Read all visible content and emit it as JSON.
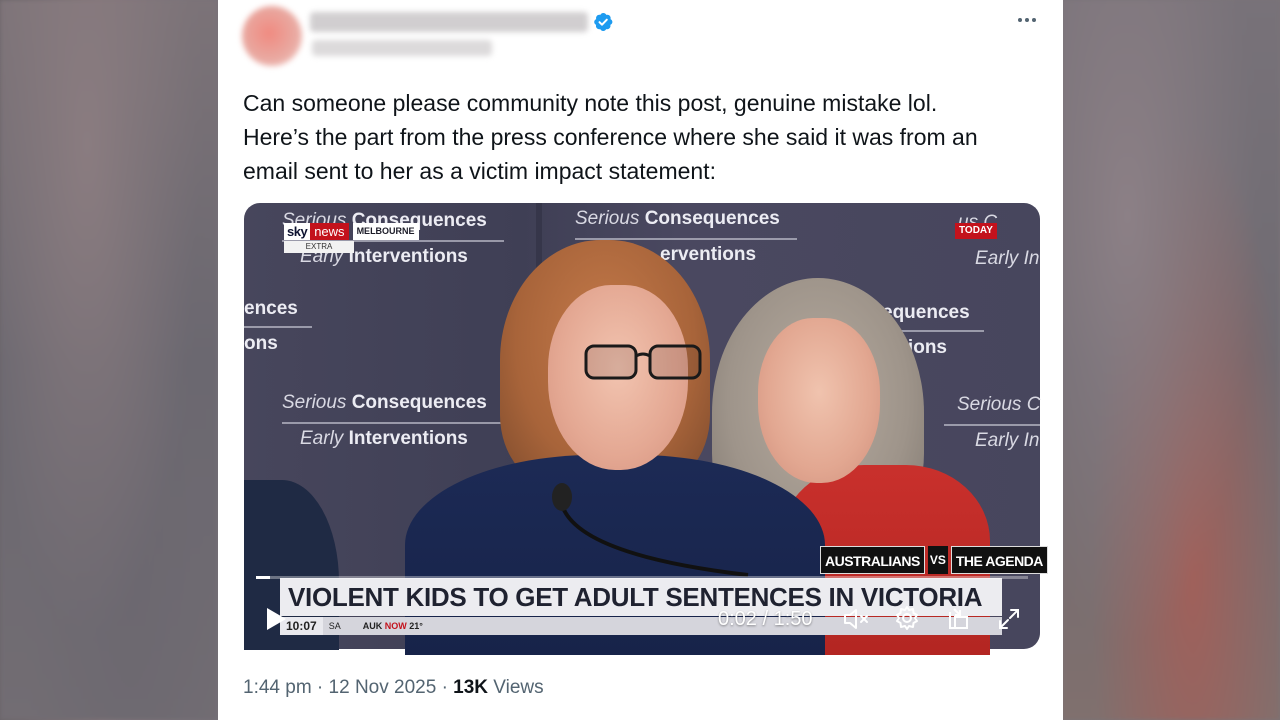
{
  "post": {
    "text_lines": [
      "Can someone please community note this post, genuine mistake lol.",
      "Here’s the part from the press conference where she said it was from an",
      "email sent to her as a victim impact statement:"
    ],
    "timestamp": "1:44 pm · 12 Nov 2025 · ",
    "views_count": "13K",
    "views_label": " Views"
  },
  "video": {
    "backdrop_serious": "Serious",
    "backdrop_consequences": "Consequences",
    "backdrop_early": "Early",
    "backdrop_interventions": "Interventions",
    "backdrop_frag_ences": "ences",
    "backdrop_frag_ons": "ons",
    "backdrop_frag_sequences": "equences",
    "backdrop_frag_ntions": "ntions",
    "backdrop_frag_terventions": "erventions",
    "backdrop_frag_serious_c": "Serious C",
    "backdrop_frag_early_in": "Early In",
    "backdrop_frag_us_c": "us C",
    "backdrop_frag_ces": "ces",
    "channel_sky": "sky",
    "channel_news": "news",
    "channel_city": "MELBOURNE",
    "channel_extra": "EXTRA",
    "today_badge": "TODAY",
    "program_left": "AUSTRALIANS",
    "program_vs": "VS",
    "program_right": "THE AGENDA",
    "headline": "VIOLENT KIDS TO GET ADULT SENTENCES IN VICTORIA",
    "ticker_time": "10:07",
    "ticker_zone": "SA",
    "ticker_auk": "AUK",
    "ticker_now": "NOW",
    "ticker_temp": "21°",
    "time_display": "0:02 / 1:50",
    "progress_fraction": 0.0178
  },
  "colors": {
    "verified": "#1d9bf0",
    "sky_red": "#c3121c",
    "text_secondary": "#536471",
    "text_primary": "#0f1419"
  },
  "icons": {
    "verified": "verified-badge-icon",
    "more": "more-options-icon",
    "play": "play-icon",
    "mute": "volume-muted-icon",
    "settings": "gear-icon",
    "pip": "picture-in-picture-icon",
    "fullscreen": "fullscreen-icon"
  }
}
